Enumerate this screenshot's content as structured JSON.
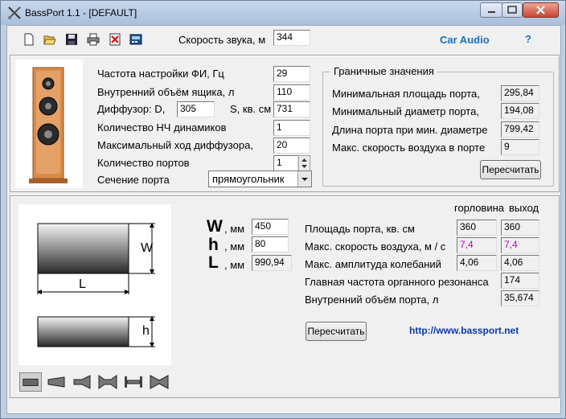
{
  "window": {
    "title": "BassPort 1.1 - [DEFAULT]"
  },
  "toolbar": {
    "icons": [
      "new-file-icon",
      "open-folder-icon",
      "save-icon",
      "print-icon",
      "delete-icon",
      "calculator-icon"
    ],
    "speed_label": "Скорость звука, м",
    "speed_value": "344",
    "car_audio": "Car Audio",
    "help": "?"
  },
  "params": {
    "tuning_label": "Частота настройки ФИ, Гц",
    "tuning_value": "29",
    "volume_label": "Внутренний объём ящика, л",
    "volume_value": "110",
    "diffuser_d_label": "Диффузор: D,",
    "diffuser_d_value": "305",
    "diffuser_s_label": "S, кв. см",
    "diffuser_s_value": "731",
    "drivers_label": "Количество НЧ динамиков",
    "drivers_value": "1",
    "xmax_label": "Максимальный ход диффузора,",
    "xmax_value": "20",
    "ports_label": "Количество портов",
    "ports_value": "1",
    "section_label": "Сечение порта",
    "section_value": "прямоугольник"
  },
  "limits": {
    "title": "Граничные значения",
    "min_area_label": "Минимальная площадь порта,",
    "min_area_value": "295,84",
    "min_diam_label": "Минимальный диаметр порта,",
    "min_diam_value": "194,08",
    "port_len_label": "Длина порта при мин. диаметре",
    "port_len_value": "799,42",
    "max_air_label": "Макс. скорость воздуха в порте",
    "max_air_value": "9",
    "recalc": "Пересчитать"
  },
  "port": {
    "w_letter": "W",
    "w_unit": ", мм",
    "w_value": "450",
    "h_letter": "h",
    "h_unit": ", мм",
    "h_value": "80",
    "l_letter": "L",
    "l_unit": ", мм",
    "l_value": "990,94",
    "diagram_w": "W",
    "diagram_l": "L",
    "diagram_h": "h",
    "col_throat": "горловина",
    "col_exit": "выход",
    "area_label": "Площадь порта, кв. см",
    "area_throat": "360",
    "area_exit": "360",
    "air_label": "Макс. скорость воздуха, м / с",
    "air_throat": "7,4",
    "air_exit": "7,4",
    "amp_label": "Макс. амплитуда колебаний",
    "amp_throat": "4,06",
    "amp_exit": "4,06",
    "organ_label": "Главная частота органного резонанса",
    "organ_value": "174",
    "inner_label": "Внутренний объём порта, л",
    "inner_value": "35,674",
    "recalc": "Пересчитать",
    "url": "http://www.bassport.net"
  },
  "colors": {
    "link_blue": "#0a3aa8",
    "car_audio": "#1c6fc4",
    "magenta": "#c000c0",
    "speaker_wood": "#d88a4a"
  }
}
